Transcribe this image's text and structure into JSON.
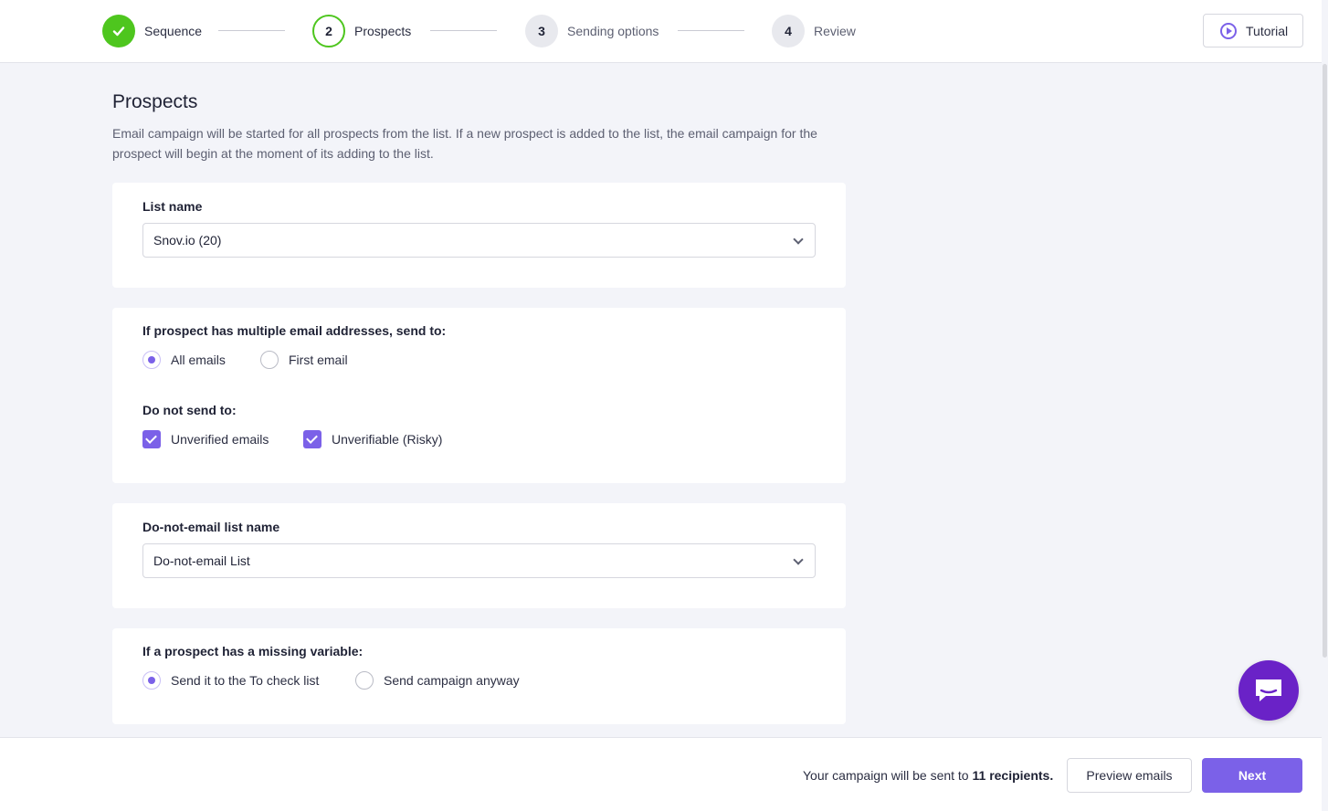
{
  "stepper": {
    "steps": [
      {
        "number": "",
        "label": "Sequence",
        "state": "done"
      },
      {
        "number": "2",
        "label": "Prospects",
        "state": "active"
      },
      {
        "number": "3",
        "label": "Sending options",
        "state": "pending"
      },
      {
        "number": "4",
        "label": "Review",
        "state": "pending"
      }
    ]
  },
  "header": {
    "tutorial_label": "Tutorial"
  },
  "page": {
    "title": "Prospects",
    "description": "Email campaign will be started for all prospects from the list. If a new prospect is added to the list, the email campaign for the prospect will begin at the moment of its adding to the list."
  },
  "list_card": {
    "title": "List name",
    "selected": "Snov.io (20)"
  },
  "multiple_email_card": {
    "title": "If prospect has multiple email addresses, send to:",
    "options": [
      {
        "label": "All emails",
        "checked": true
      },
      {
        "label": "First email",
        "checked": false
      }
    ],
    "exclude_title": "Do not send to:",
    "exclude_options": [
      {
        "label": "Unverified emails",
        "checked": true
      },
      {
        "label": "Unverifiable (Risky)",
        "checked": true
      }
    ]
  },
  "dne_card": {
    "title": "Do-not-email list name",
    "selected": "Do-not-email List"
  },
  "missing_var_card": {
    "title": "If a prospect has a missing variable:",
    "options": [
      {
        "label": "Send it to the To check list",
        "checked": true
      },
      {
        "label": "Send campaign anyway",
        "checked": false
      }
    ]
  },
  "footer": {
    "text_prefix": "Your campaign will be sent to",
    "recipients_count": "11",
    "recipients_word": "recipients.",
    "preview_label": "Preview emails",
    "next_label": "Next"
  },
  "colors": {
    "accent": "#7b61e8",
    "success": "#4ec61e",
    "chat": "#6a22c7"
  }
}
